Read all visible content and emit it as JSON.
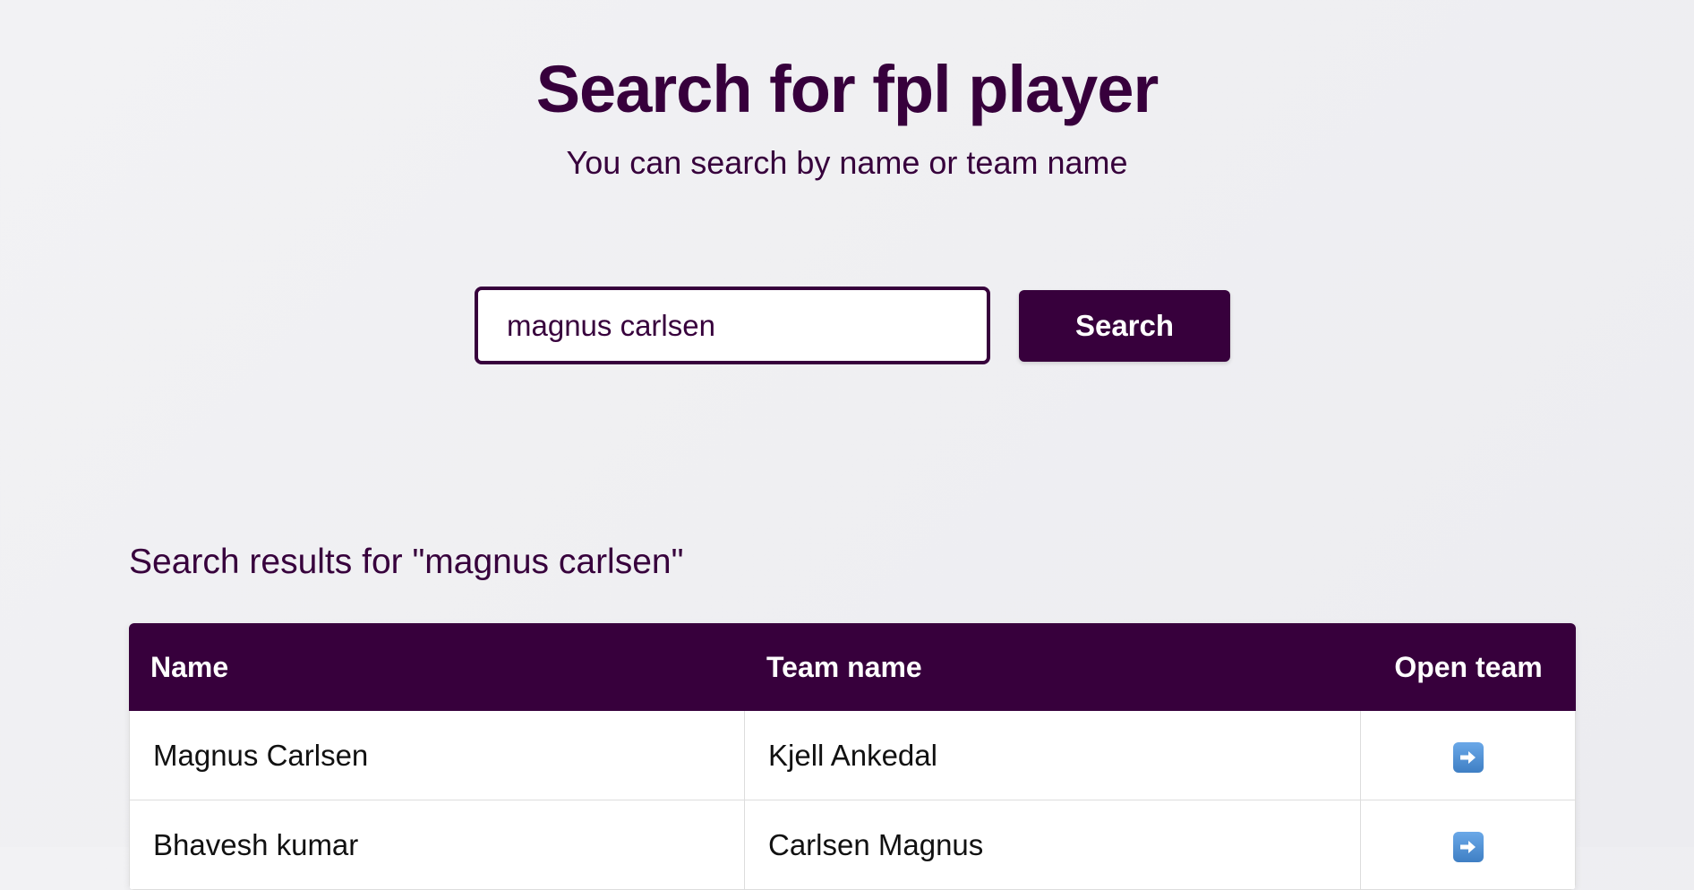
{
  "header": {
    "title": "Search for fpl player",
    "subtitle": "You can search by name or team name"
  },
  "search": {
    "input_value": "magnus carlsen",
    "button_label": "Search"
  },
  "results": {
    "heading": "Search results for \"magnus carlsen\"",
    "columns": [
      "Name",
      "Team name",
      "Open team"
    ],
    "rows": [
      {
        "name": "Magnus Carlsen",
        "team_name": "Kjell Ankedal",
        "open_icon": "right-arrow-icon"
      },
      {
        "name": "Bhavesh kumar",
        "team_name": "Carlsen Magnus",
        "open_icon": "right-arrow-icon"
      }
    ]
  },
  "colors": {
    "brand": "#37003c",
    "background": "#f0f0f3",
    "icon_blue": "#4a90d9"
  }
}
